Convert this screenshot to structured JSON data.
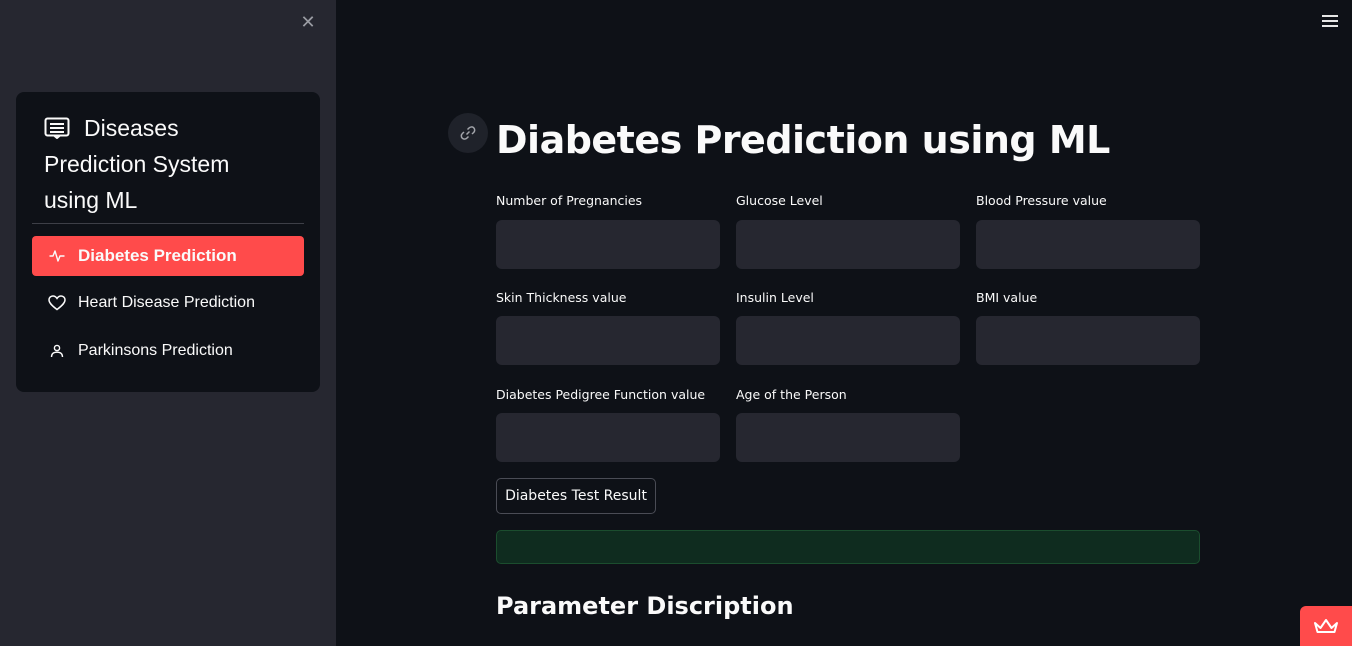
{
  "sidebar": {
    "close_icon": "close-icon",
    "menu_title": "Diseases Prediction System using ML",
    "menu_title_icon": "clipboard-list-icon",
    "items": [
      {
        "label": "Diabetes Prediction",
        "icon": "activity-icon",
        "active": true
      },
      {
        "label": "Heart Disease Prediction",
        "icon": "heart-icon",
        "active": false
      },
      {
        "label": "Parkinsons Prediction",
        "icon": "person-icon",
        "active": false
      }
    ],
    "active_color": "#ff4b4b"
  },
  "header": {
    "menu_icon": "hamburger-icon"
  },
  "main": {
    "title": "Diabetes Prediction using ML",
    "anchor_icon": "link-icon",
    "fields": [
      {
        "label": "Number of Pregnancies",
        "value": ""
      },
      {
        "label": "Glucose Level",
        "value": ""
      },
      {
        "label": "Blood Pressure value",
        "value": ""
      },
      {
        "label": "Skin Thickness value",
        "value": ""
      },
      {
        "label": "Insulin Level",
        "value": ""
      },
      {
        "label": "BMI value",
        "value": ""
      },
      {
        "label": "Diabetes Pedigree Function value",
        "value": ""
      },
      {
        "label": "Age of the Person",
        "value": ""
      }
    ],
    "submit_label": "Diabetes Test Result",
    "result_text": "",
    "section_heading": "Parameter Discription"
  },
  "footer": {
    "badge_icon": "crown-icon"
  },
  "colors": {
    "background": "#0e1117",
    "sidebar": "#262730",
    "accent": "#ff4b4b",
    "success_bg": "#0f2c1f"
  }
}
